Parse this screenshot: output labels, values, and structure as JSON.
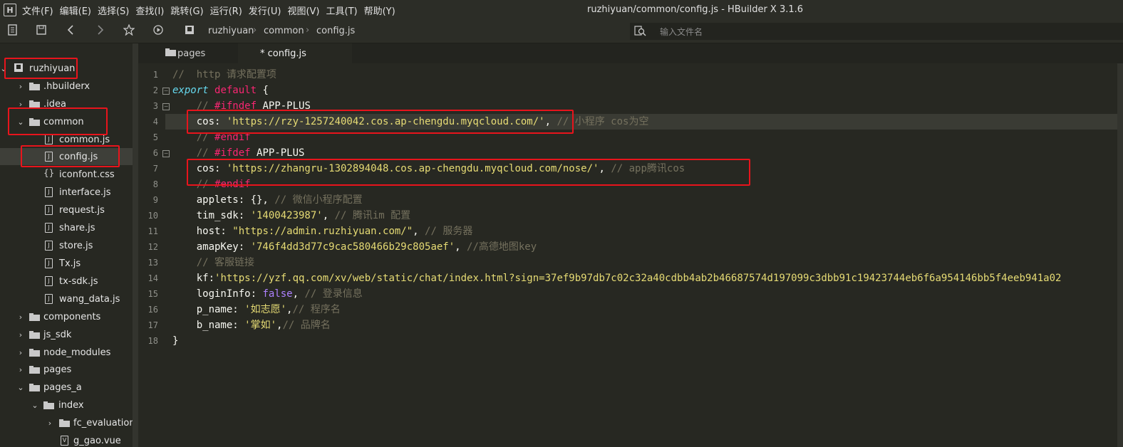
{
  "menubar": {
    "logo": "H",
    "items": [
      "文件(F)",
      "编辑(E)",
      "选择(S)",
      "查找(I)",
      "跳转(G)",
      "运行(R)",
      "发行(U)",
      "视图(V)",
      "工具(T)",
      "帮助(Y)"
    ],
    "title": "ruzhiyuan/common/config.js - HBuilder X 3.1.6"
  },
  "toolbar": {
    "breadcrumb": [
      "ruzhiyuan",
      "common",
      "config.js"
    ],
    "search_placeholder": "输入文件名",
    "icons": [
      "new-file-icon",
      "save-icon",
      "back-icon",
      "forward-icon",
      "star-icon",
      "run-icon",
      "project-icon",
      "search-icon"
    ]
  },
  "sidebar": {
    "items": [
      {
        "label": "ruzhiyuan",
        "type": "project",
        "depth": 0,
        "expanded": true
      },
      {
        "label": ".hbuilderx",
        "type": "folder",
        "depth": 1,
        "expanded": false
      },
      {
        "label": ".idea",
        "type": "folder",
        "depth": 1,
        "expanded": false
      },
      {
        "label": "common",
        "type": "folder",
        "depth": 1,
        "expanded": true
      },
      {
        "label": "common.js",
        "type": "file",
        "depth": 2
      },
      {
        "label": "config.js",
        "type": "file",
        "depth": 2,
        "selected": true
      },
      {
        "label": "iconfont.css",
        "type": "css",
        "depth": 2
      },
      {
        "label": "interface.js",
        "type": "file",
        "depth": 2
      },
      {
        "label": "request.js",
        "type": "file",
        "depth": 2
      },
      {
        "label": "share.js",
        "type": "file",
        "depth": 2
      },
      {
        "label": "store.js",
        "type": "file",
        "depth": 2
      },
      {
        "label": "Tx.js",
        "type": "file",
        "depth": 2
      },
      {
        "label": "tx-sdk.js",
        "type": "file",
        "depth": 2
      },
      {
        "label": "wang_data.js",
        "type": "file",
        "depth": 2
      },
      {
        "label": "components",
        "type": "folder",
        "depth": 1,
        "expanded": false
      },
      {
        "label": "js_sdk",
        "type": "folder",
        "depth": 1,
        "expanded": false
      },
      {
        "label": "node_modules",
        "type": "folder",
        "depth": 1,
        "expanded": false
      },
      {
        "label": "pages",
        "type": "folder",
        "depth": 1,
        "expanded": false
      },
      {
        "label": "pages_a",
        "type": "folder",
        "depth": 1,
        "expanded": true
      },
      {
        "label": "index",
        "type": "folder",
        "depth": 2,
        "expanded": true
      },
      {
        "label": "fc_evaluation",
        "type": "folder",
        "depth": 3,
        "expanded": false
      },
      {
        "label": "g_gao.vue",
        "type": "vue",
        "depth": 3
      }
    ]
  },
  "tabs": [
    {
      "label": "pages",
      "active": false
    },
    {
      "label": "* config.js",
      "active": true
    }
  ],
  "editor": {
    "lines": [
      "//  http 请求配置项",
      "export default {",
      "    // #ifndef APP-PLUS",
      "    cos: 'https://rzy-1257240042.cos.ap-chengdu.myqcloud.com/', // 小程序 cos为空",
      "    // #endif",
      "    // #ifdef APP-PLUS",
      "    cos: 'https://zhangru-1302894048.cos.ap-chengdu.myqcloud.com/nose/', // app腾讯cos",
      "    // #endif",
      "    applets: {}, // 微信小程序配置",
      "    tim_sdk: '1400423987', // 腾讯im 配置",
      "    host: \"https://admin.ruzhiyuan.com/\", // 服务器",
      "    amapKey: '746f4dd3d77c9cac580466b29c805aef', //高德地图key",
      "    // 客服链接",
      "    kf:'https://yzf.qq.com/xv/web/static/chat/index.html?sign=37ef9b97db7c02c32a40cdbb4ab2b46687574d197099c3dbb91c19423744eb6f6a954146bb5f4eeb941a02",
      "    loginInfo: false, // 登录信息",
      "    p_name: '如志愿',// 程序名",
      "    b_name: '掌如',// 品牌名",
      "}"
    ],
    "line_numbers": [
      "1",
      "2",
      "3",
      "4",
      "5",
      "6",
      "7",
      "8",
      "9",
      "10",
      "11",
      "12",
      "13",
      "14",
      "15",
      "16",
      "17",
      "18"
    ],
    "current_line": 4
  },
  "colors": {
    "background": "#272822",
    "comment": "#75715e",
    "string": "#e6db74",
    "keyword": "#66d9ef",
    "highlight_box": "#e8141c"
  }
}
